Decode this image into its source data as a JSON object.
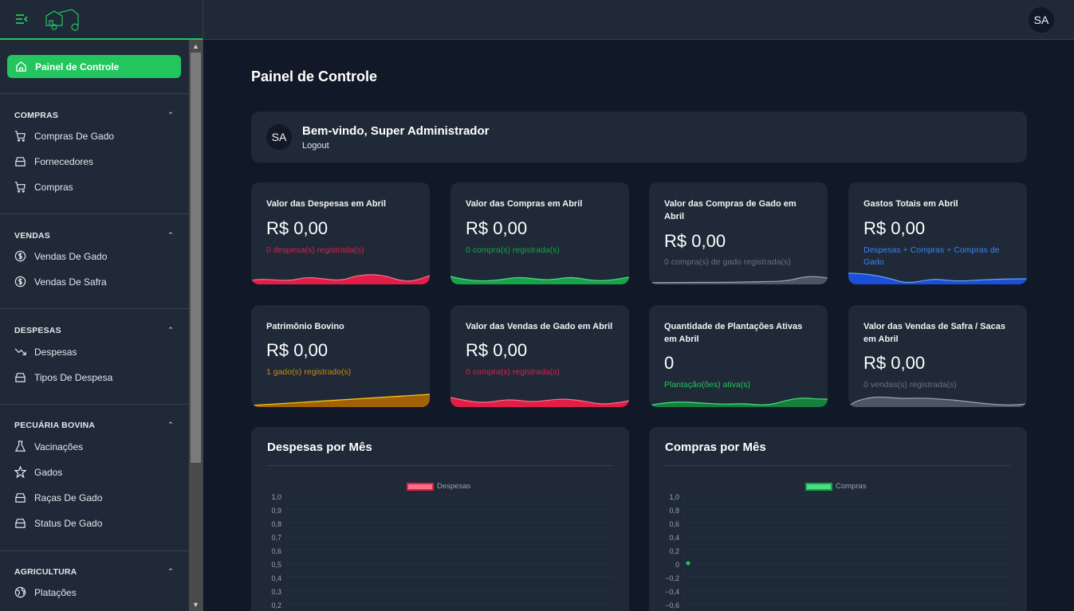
{
  "sidebar": {
    "active": "Painel de Controle",
    "sections": [
      {
        "title": "COMPRAS",
        "items": [
          "Compras De Gado",
          "Fornecedores",
          "Compras"
        ]
      },
      {
        "title": "VENDAS",
        "items": [
          "Vendas De Gado",
          "Vendas De Safra"
        ]
      },
      {
        "title": "DESPESAS",
        "items": [
          "Despesas",
          "Tipos De Despesa"
        ]
      },
      {
        "title": "PECUÁRIA BOVINA",
        "items": [
          "Vacinações",
          "Gados",
          "Raças De Gado",
          "Status De Gado"
        ]
      },
      {
        "title": "AGRICULTURA",
        "items": [
          "Platações"
        ]
      }
    ]
  },
  "topbar": {
    "avatar": "SA"
  },
  "page": {
    "title": "Painel de Controle"
  },
  "welcome": {
    "avatar": "SA",
    "message": "Bem-vindo, Super Administrador",
    "logout": "Logout"
  },
  "cards": [
    {
      "title": "Valor das Despesas em Abril",
      "value": "R$ 0,00",
      "sub": "0 despesa(s) registrada(s)",
      "color": "#e11d48"
    },
    {
      "title": "Valor das Compras em Abril",
      "value": "R$ 0,00",
      "sub": "0 compra(s) registrada(s)",
      "color": "#16a34a"
    },
    {
      "title": "Valor das Compras de Gado em Abril",
      "value": "R$ 0,00",
      "sub": "0 compra(s) de gado registrada(s)",
      "color": "#6b7280"
    },
    {
      "title": "Gastos Totais em Abril",
      "value": "R$ 0,00",
      "sub": "Despesas + Compras + Compras de Gado",
      "color": "#2563eb"
    },
    {
      "title": "Patrimônio Bovino",
      "value": "R$ 0,00",
      "sub": "1 gado(s) registrado(s)",
      "color": "#ca8a04"
    },
    {
      "title": "Valor das Vendas de Gado em Abril",
      "value": "R$ 0,00",
      "sub": "0 compra(s) registrada(s)",
      "color": "#e11d48"
    },
    {
      "title": "Quantidade de Plantações Ativas em Abril",
      "value": "0",
      "sub": "Plantação(ões) ativa(s)",
      "color": "#16a34a"
    },
    {
      "title": "Valor das Vendas de Safra / Sacas em Abril",
      "value": "R$ 0,00",
      "sub": "0 vendas(s) registrada(s)",
      "color": "#6b7280"
    }
  ],
  "charts": [
    {
      "title": "Despesas por Mês",
      "legend": "Despesas",
      "color": "#f43f5e",
      "fill": "#fb7185",
      "ticks": [
        "1,0",
        "0,9",
        "0,8",
        "0,7",
        "0,6",
        "0,5",
        "0,4",
        "0,3",
        "0,2"
      ]
    },
    {
      "title": "Compras por Mês",
      "legend": "Compras",
      "color": "#22c55e",
      "fill": "#4ade80",
      "ticks": [
        "1,0",
        "0,8",
        "0,6",
        "0,4",
        "0,2",
        "0",
        "−0,2",
        "−0,4",
        "−0,6"
      ]
    }
  ]
}
